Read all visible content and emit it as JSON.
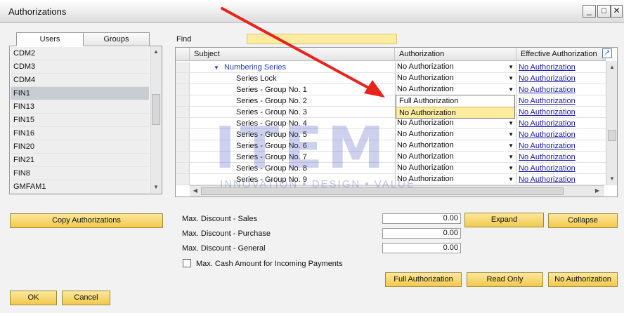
{
  "window": {
    "title": "Authorizations",
    "controls": {
      "minimize": "_",
      "maximize": "□",
      "close": "✕"
    }
  },
  "tabs": [
    {
      "label": "Users",
      "active": true
    },
    {
      "label": "Groups",
      "active": false
    }
  ],
  "users": [
    "CDM2",
    "CDM3",
    "CDM4",
    "FIN1",
    "FIN13",
    "FIN15",
    "FIN16",
    "FIN20",
    "FIN21",
    "FIN8",
    "GMFAM1"
  ],
  "selected_user": "FIN1",
  "find": {
    "label": "Find",
    "value": ""
  },
  "grid": {
    "headers": {
      "subject": "Subject",
      "authorization": "Authorization",
      "effective": "Effective Authorization"
    },
    "rows": [
      {
        "subject": "Numbering Series",
        "authorization": "No Authorization",
        "effective": "No Authorization",
        "group": true
      },
      {
        "subject": "Series Lock",
        "authorization": "No Authorization",
        "effective": "No Authorization"
      },
      {
        "subject": "Series - Group No. 1",
        "authorization": "No Authorization",
        "effective": "No Authorization"
      },
      {
        "subject": "Series - Group No. 2",
        "authorization": "",
        "effective": "No Authorization"
      },
      {
        "subject": "Series - Group No. 3",
        "authorization": "",
        "effective": "No Authorization"
      },
      {
        "subject": "Series - Group No. 4",
        "authorization": "No Authorization",
        "effective": "No Authorization"
      },
      {
        "subject": "Series - Group No. 5",
        "authorization": "No Authorization",
        "effective": "No Authorization"
      },
      {
        "subject": "Series - Group No. 6",
        "authorization": "No Authorization",
        "effective": "No Authorization"
      },
      {
        "subject": "Series - Group No. 7",
        "authorization": "No Authorization",
        "effective": "No Authorization"
      },
      {
        "subject": "Series - Group No. 8",
        "authorization": "No Authorization",
        "effective": "No Authorization"
      },
      {
        "subject": "Series - Group No. 9",
        "authorization": "No Authorization",
        "effective": "No Authorization"
      }
    ],
    "dropdown_options": [
      "Full Authorization",
      "No Authorization"
    ],
    "dropdown_highlighted": "No Authorization"
  },
  "buttons": {
    "copy": "Copy Authorizations",
    "expand": "Expand",
    "collapse": "Collapse",
    "full": "Full Authorization",
    "read_only": "Read Only",
    "no_auth": "No Authorization",
    "ok": "OK",
    "cancel": "Cancel"
  },
  "fields": [
    {
      "label": "Max. Discount - Sales",
      "value": "0.00"
    },
    {
      "label": "Max. Discount - Purchase",
      "value": "0.00"
    },
    {
      "label": "Max. Discount - General",
      "value": "0.00"
    }
  ],
  "checkbox": {
    "label": "Max. Cash Amount for Incoming Payments",
    "checked": false
  },
  "watermark": {
    "logo": "ITEM",
    "tagline": "INNOVATION • DESIGN • VALUE"
  },
  "colors": {
    "button_yellow": "#f2c94c",
    "highlight": "#fdeca0",
    "link": "#1a1aaa",
    "annotation_arrow": "#e8231b"
  }
}
